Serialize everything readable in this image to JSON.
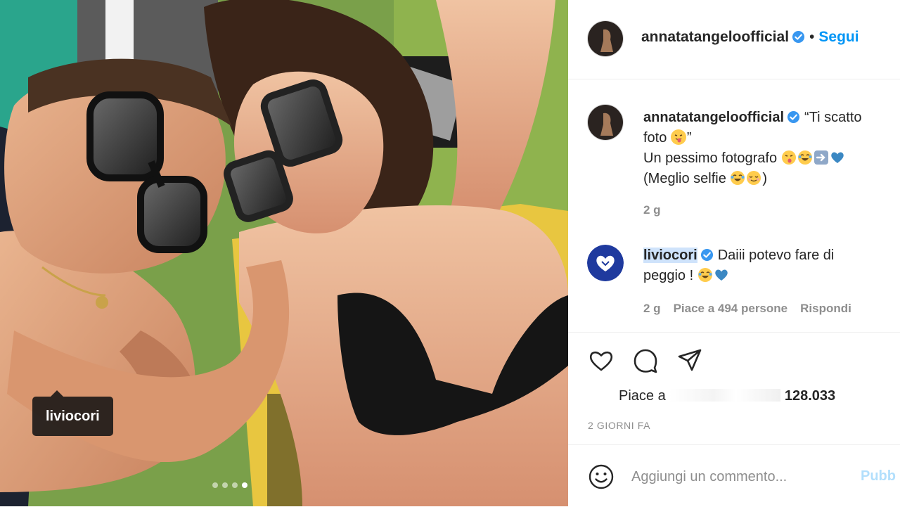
{
  "photo": {
    "tag_label": "liviocori",
    "carousel_count": 4,
    "carousel_active": 4
  },
  "header": {
    "username": "annatatangeloofficial",
    "separator": "•",
    "follow_label": "Segui"
  },
  "caption": {
    "username": "annatatangeloofficial",
    "text_line1": "“Ti scatto",
    "text_line2": "foto",
    "text_line2_end": "”",
    "text_line3": "Un pessimo fotografo",
    "text_line4": "(Meglio selfie",
    "text_line4_end": ")",
    "time": "2 g"
  },
  "reply": {
    "username": "liviocori",
    "text_line1": "Daiii potevo fare di",
    "text_line2": "peggio !",
    "time": "2 g",
    "likes": "Piace a 494 persone",
    "reply_label": "Rispondi"
  },
  "actions": {
    "icons": [
      "heart-icon",
      "comment-icon",
      "share-icon"
    ],
    "likes_prefix": "Piace a",
    "likes_count": "128.033",
    "date": "2 GIORNI FA"
  },
  "add_comment": {
    "placeholder": "Aggiungi un commento...",
    "post_label": "Pubb"
  },
  "colors": {
    "link_blue": "#0095f6",
    "verified_blue": "#3897f0",
    "post_disabled": "#b2dffc",
    "meta_gray": "#8e8e8e"
  }
}
